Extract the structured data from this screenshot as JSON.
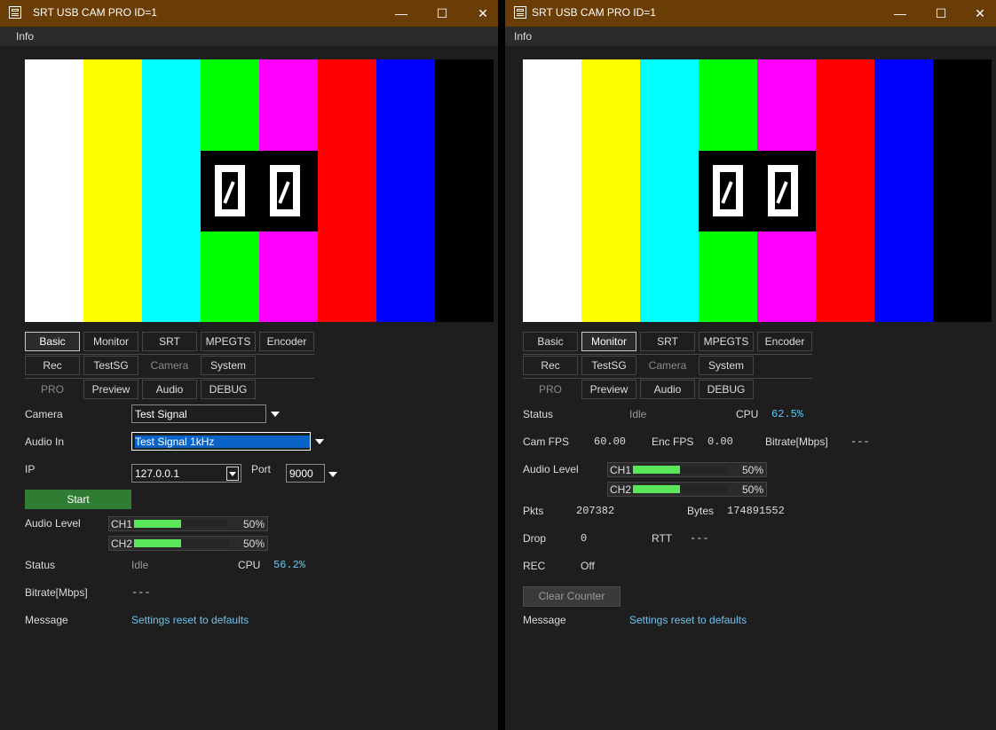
{
  "windows": [
    {
      "title": "SRT USB CAM PRO ID=1",
      "menu": "Info",
      "tabs": [
        "Basic",
        "Monitor",
        "SRT",
        "MPEGTS",
        "Encoder",
        "Rec",
        "TestSG",
        "Camera",
        "System",
        "PRO",
        "Preview",
        "Audio",
        "DEBUG"
      ],
      "active_tab": "Basic"
    },
    {
      "title": "SRT USB CAM PRO ID=1",
      "menu": "Info",
      "tabs": [
        "Basic",
        "Monitor",
        "SRT",
        "MPEGTS",
        "Encoder",
        "Rec",
        "TestSG",
        "Camera",
        "System",
        "PRO",
        "Preview",
        "Audio",
        "DEBUG"
      ],
      "active_tab": "Monitor"
    }
  ],
  "window_buttons": {
    "minimize": "—",
    "maximize": "☐",
    "close": "✕"
  },
  "colorbars": [
    "#ffffff",
    "#ffff00",
    "#00ffff",
    "#00ff00",
    "#ff00ff",
    "#ff0000",
    "#0000ff",
    "#000000"
  ],
  "basic": {
    "camera_label": "Camera",
    "camera_value": "Test Signal",
    "audio_in_label": "Audio In",
    "audio_in_value": "Test Signal 1kHz",
    "ip_label": "IP",
    "ip_value": "127.0.0.1",
    "port_label": "Port",
    "port_value": "9000",
    "start_label": "Start",
    "audio_level_label": "Audio Level",
    "ch1_label": "CH1",
    "ch1_pct": "50%",
    "ch1_level": 0.5,
    "ch2_label": "CH2",
    "ch2_pct": "50%",
    "ch2_level": 0.5,
    "status_label": "Status",
    "status_value": "Idle",
    "cpu_label": "CPU",
    "cpu_value": "56.2%",
    "bitrate_label": "Bitrate[Mbps]",
    "bitrate_value": "---",
    "message_label": "Message",
    "message_value": "Settings reset to defaults"
  },
  "monitor": {
    "status_label": "Status",
    "status_value": "Idle",
    "cpu_label": "CPU",
    "cpu_value": "62.5%",
    "cam_fps_label": "Cam FPS",
    "cam_fps_value": "60.00",
    "enc_fps_label": "Enc FPS",
    "enc_fps_value": "0.00",
    "bitrate_label": "Bitrate[Mbps]",
    "bitrate_value": "---",
    "audio_level_label": "Audio Level",
    "ch1_label": "CH1",
    "ch1_pct": "50%",
    "ch1_level": 0.5,
    "ch2_label": "CH2",
    "ch2_pct": "50%",
    "ch2_level": 0.5,
    "pkts_label": "Pkts",
    "pkts_value": "207382",
    "bytes_label": "Bytes",
    "bytes_value": "174891552",
    "drop_label": "Drop",
    "drop_value": "0",
    "rtt_label": "RTT",
    "rtt_value": "---",
    "rec_label": "REC",
    "rec_value": "Off",
    "clear_label": "Clear Counter",
    "message_label": "Message",
    "message_value": "Settings reset to defaults"
  }
}
